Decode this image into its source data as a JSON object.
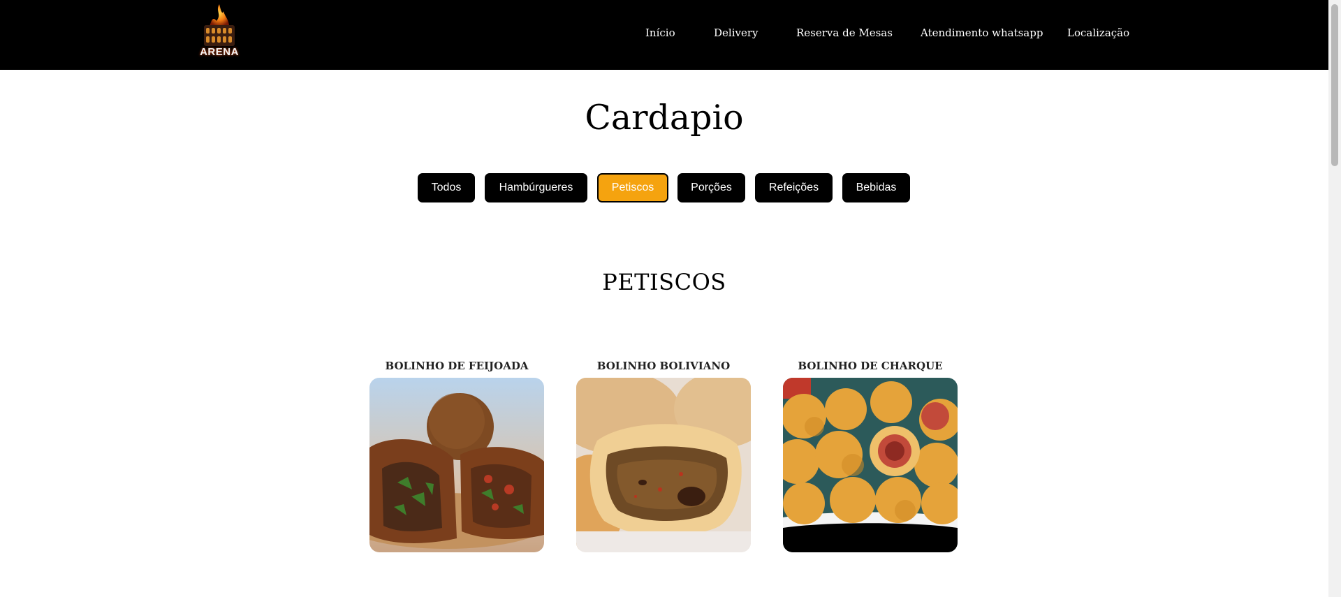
{
  "header": {
    "logo_text": "ARENA",
    "nav": [
      {
        "label": "Início"
      },
      {
        "label": "Delivery"
      },
      {
        "label": "Reserva de Mesas"
      },
      {
        "label": "Atendimento whatsapp"
      },
      {
        "label": "Localização"
      }
    ]
  },
  "main": {
    "title": "Cardapio",
    "filters": [
      {
        "label": "Todos",
        "active": false
      },
      {
        "label": "Hambúrgueres",
        "active": false
      },
      {
        "label": "Petiscos",
        "active": true
      },
      {
        "label": "Porções",
        "active": false
      },
      {
        "label": "Refeições",
        "active": false
      },
      {
        "label": "Bebidas",
        "active": false
      }
    ],
    "section_title": "PETISCOS",
    "items": [
      {
        "name": "BOLINHO DE FEIJOADA",
        "image_icon": "bolinho-feijoada-photo"
      },
      {
        "name": "BOLINHO BOLIVIANO",
        "image_icon": "bolinho-boliviano-photo"
      },
      {
        "name": "BOLINHO DE CHARQUE",
        "image_icon": "bolinho-charque-photo"
      }
    ]
  },
  "colors": {
    "header_bg": "#000000",
    "accent": "#f5a30f",
    "button_bg": "#000000",
    "text": "#000000"
  }
}
